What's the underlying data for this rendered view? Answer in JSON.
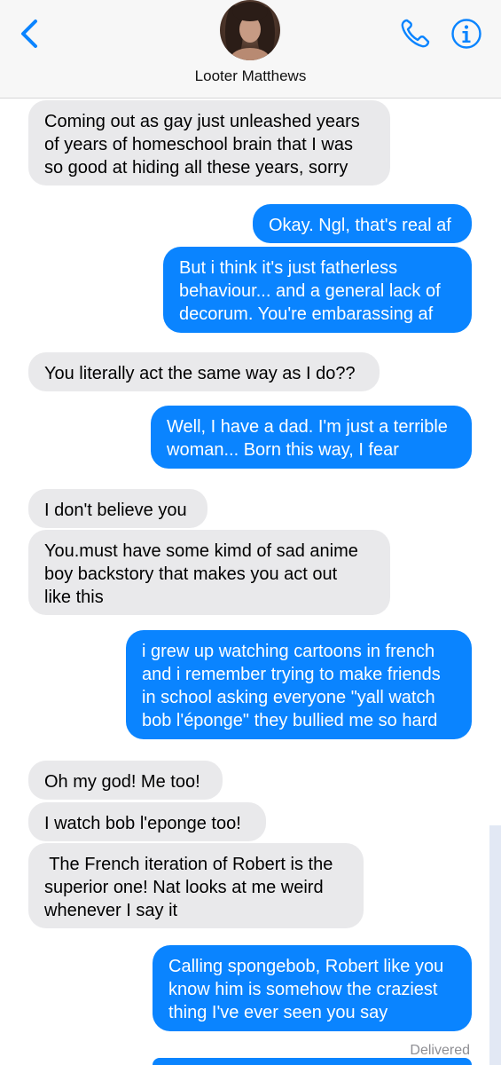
{
  "header": {
    "contact_name": "Looter Matthews",
    "back_icon": "chevron-left-icon",
    "phone_icon": "phone-icon",
    "info_icon": "info-icon",
    "accent_color": "#0a84ff"
  },
  "messages": [
    {
      "direction": "incoming",
      "lines": [
        "Coming out as gay just unleashed years",
        "of years of homeschool brain that I was",
        "so good at hiding all these years, sorry"
      ]
    },
    {
      "direction": "outgoing",
      "lines": [
        "Okay. Ngl, that's real af"
      ]
    },
    {
      "direction": "outgoing",
      "lines": [
        "But i think it's just fatherless",
        "behaviour...  and a general lack of",
        "decorum. You're embarassing af"
      ]
    },
    {
      "direction": "incoming",
      "lines": [
        "You literally act the same way as I do??"
      ]
    },
    {
      "direction": "outgoing",
      "lines": [
        "Well, I have a dad. I'm just a terrible",
        "woman... Born this way, I fear"
      ]
    },
    {
      "direction": "incoming",
      "lines": [
        "I don't believe you"
      ]
    },
    {
      "direction": "incoming",
      "lines": [
        "You.must have some kimd of sad anime",
        "boy backstory that makes you act out",
        "like this"
      ]
    },
    {
      "direction": "outgoing",
      "lines": [
        "i grew up watching cartoons in french",
        "and i remember trying to make friends",
        "in school asking everyone \"yall watch",
        "bob l'éponge\" they bullied me so hard"
      ]
    },
    {
      "direction": "incoming",
      "lines": [
        "Oh my god! Me too!"
      ]
    },
    {
      "direction": "incoming",
      "lines": [
        "I watch bob l'eponge too!"
      ]
    },
    {
      "direction": "incoming",
      "lines": [
        " The French iteration of Robert is the",
        "superior one! Nat looks at me weird",
        "whenever I say it"
      ]
    },
    {
      "direction": "outgoing",
      "lines": [
        "Calling spongebob, Robert like you",
        "know him is somehow the craziest",
        "thing I've ever seen you say"
      ]
    }
  ],
  "status": {
    "delivered": "Delivered"
  }
}
